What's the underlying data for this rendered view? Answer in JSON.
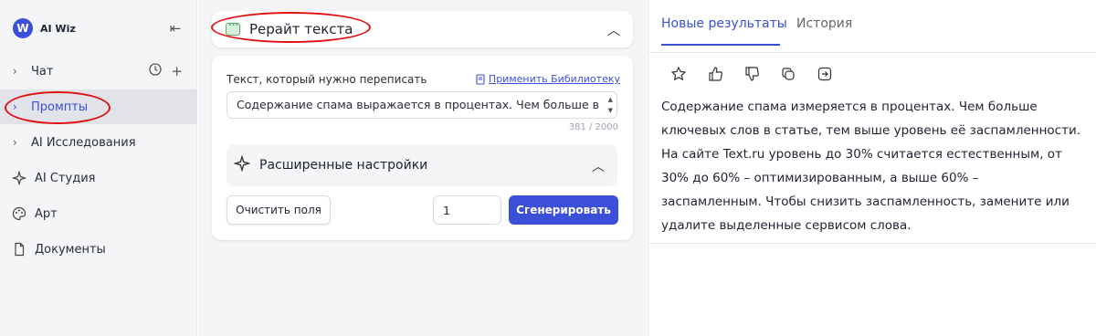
{
  "app": {
    "name": "AI Wiz",
    "logo_letter": "W"
  },
  "sidebar": {
    "items": [
      {
        "label": "Чат",
        "icon": "chevron-right"
      },
      {
        "label": "Промпты",
        "icon": "chevron-right",
        "active": true
      },
      {
        "label": "AI Исследования",
        "icon": "chevron-right"
      },
      {
        "label": "AI Студия",
        "icon": "sparkle-icon"
      },
      {
        "label": "Арт",
        "icon": "palette-icon"
      },
      {
        "label": "Документы",
        "icon": "document-icon"
      }
    ]
  },
  "tool": {
    "title": "Рерайт текста",
    "field_label": "Текст, который нужно переписать",
    "library_link": "Применить Бибилиотеку",
    "input_value": "Содержание спама выражается в процентах. Чем больше в",
    "char_count": "381 / 2000",
    "advanced_title": "Расширенные настройки",
    "clear_button": "Очистить поля",
    "quantity": "1",
    "generate_button": "Сгенерировать"
  },
  "results": {
    "tabs": [
      "Новые результаты",
      "История"
    ],
    "text": "Содержание спама измеряется в процентах. Чем больше ключевых слов в статье, тем выше уровень её заспамленности. На сайте Text.ru уровень до 30% считается естественным, от 30% до 60% – оптимизированным, а выше 60% – заспамленным. Чтобы снизить заспамленность, замените или удалите выделенные сервисом слова."
  },
  "colors": {
    "accent": "#3b4fd8",
    "annotation": "#e01010",
    "sidebar_bg": "#f4f5f7"
  }
}
